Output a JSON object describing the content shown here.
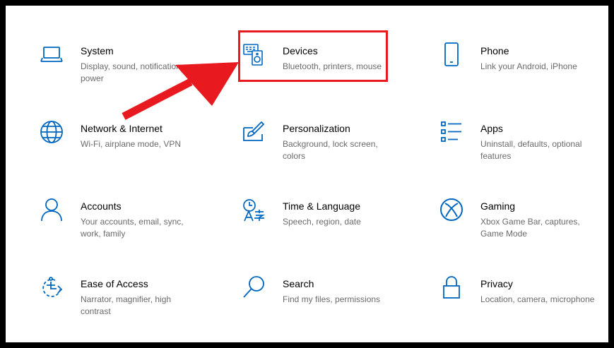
{
  "colors": {
    "accent": "#0067c0",
    "annotation": "#e8191f",
    "description_text": "#6b6b6b",
    "title_text": "#000000",
    "frame_border": "#000000"
  },
  "tiles": [
    {
      "name": "system",
      "title": "System",
      "description": "Display, sound, notifications, power",
      "icon": "laptop-icon"
    },
    {
      "name": "devices",
      "title": "Devices",
      "description": "Bluetooth, printers, mouse",
      "icon": "devices-icon"
    },
    {
      "name": "phone",
      "title": "Phone",
      "description": "Link your Android, iPhone",
      "icon": "phone-icon"
    },
    {
      "name": "network",
      "title": "Network & Internet",
      "description": "Wi-Fi, airplane mode, VPN",
      "icon": "globe-icon"
    },
    {
      "name": "personalization",
      "title": "Personalization",
      "description": "Background, lock screen, colors",
      "icon": "paintbrush-icon"
    },
    {
      "name": "apps",
      "title": "Apps",
      "description": "Uninstall, defaults, optional features",
      "icon": "apps-list-icon"
    },
    {
      "name": "accounts",
      "title": "Accounts",
      "description": "Your accounts, email, sync, work, family",
      "icon": "person-icon"
    },
    {
      "name": "time-language",
      "title": "Time & Language",
      "description": "Speech, region, date",
      "icon": "time-language-icon"
    },
    {
      "name": "gaming",
      "title": "Gaming",
      "description": "Xbox Game Bar, captures, Game Mode",
      "icon": "xbox-icon"
    },
    {
      "name": "ease-of-access",
      "title": "Ease of Access",
      "description": "Narrator, magnifier, high contrast",
      "icon": "ease-of-access-icon"
    },
    {
      "name": "search",
      "title": "Search",
      "description": "Find my files, permissions",
      "icon": "search-icon"
    },
    {
      "name": "privacy",
      "title": "Privacy",
      "description": "Location, camera, microphone",
      "icon": "lock-icon"
    }
  ],
  "annotation": {
    "highlighted_tile": "devices",
    "arrow_target": "devices"
  }
}
